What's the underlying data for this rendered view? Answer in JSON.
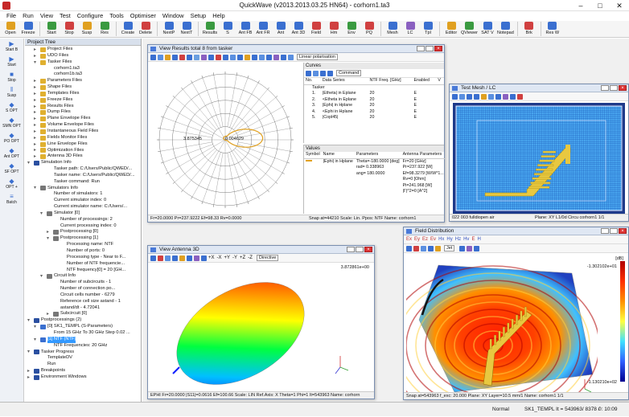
{
  "app": {
    "title": "QuickWave (v2013.2013.03.25 HN64) - corhorn1.ta3"
  },
  "menu": [
    "File",
    "Run",
    "View",
    "Test",
    "Configure",
    "Tools",
    "Optimiser",
    "Window",
    "Setup",
    "Help"
  ],
  "toolbar": [
    "Open",
    "Freeze",
    "Start",
    "Stop",
    "Susp",
    "Res",
    "Create",
    "Delete",
    "NextP",
    "NextT",
    "Results",
    "S",
    "Ant FB",
    "Ant FR",
    "Ant",
    "Ant 3D",
    "Field",
    "Hm",
    "Env",
    "PQ",
    "Mesh",
    "LC",
    "Tpl",
    "Editor",
    "QViewer",
    "SAT V",
    "Notepad",
    "Brk",
    "Res W"
  ],
  "leftstrip": [
    "Start B",
    "Start",
    "Stop",
    "Susp",
    "S OPT",
    "SMN OPT",
    "PO OPT",
    "Ant OPT",
    "SF OPT",
    "OPT +",
    "Batch"
  ],
  "tree": {
    "title": "Project Tree",
    "items": [
      "Project Files",
      "UDO Files",
      "Tasker Files",
      "corhorn1.ta3",
      "corhorn1b.ta3",
      "Parameters Files",
      "Shape Files",
      "Templates Files",
      "Freeze Files",
      "Results Files",
      "Dump Files",
      "Plane Envelope Files",
      "Volume Envelope Files",
      "Instantaneous Field Files",
      "Fields Monitor Files",
      "Line Envelope Files",
      "Optimization Files",
      "Antenna 3D Files",
      "Simulation Info",
      "Tasker path: C:/Users/Public/QWED/...",
      "Tasker name: C:/Users/Public/QWED/...",
      "Tasker command: Run",
      "Simulators Info",
      "Number of simulators: 1",
      "Current simulator index: 0",
      "Current simulator name: C:/Users/...",
      "Simulator [0]",
      "Number of processings: 2",
      "Current processing index: 0",
      "Postprocessing [0]",
      "Postprocessing [1]",
      "Processing name: NTF",
      "Number of ports: 0",
      "Processing type - Near to F...",
      "Number of NTF frequencie...",
      "NTF frequency[0] = 20 [GH...",
      "Circuit Info",
      "Number of subcircuits - 1",
      "Number of connection po...",
      "Circuit cells number - 6279",
      "Reference cell size astand - 1",
      "astand/dt - 4.72041",
      "Subcircuit [0]",
      "Postprocessings (2)",
      "[0] SK1_TEMPL (S-Parameters)",
      "From 15 GHz To 30 GHz Step 0.02 ...",
      "[1] NTF (NTF)",
      "NTF Frequencies: 20 GHz",
      "Tasker Progress",
      "TemplateDV",
      "Run",
      "Breakpoints",
      "Environment Windows"
    ]
  },
  "win_results": {
    "title": "View Results total 8 from tasker",
    "polarisation": "Linear polarisation",
    "label_a": "3.875345",
    "label_b": "0.004629",
    "status": "Fr=20.0000  Pr=237.9222  Ef=98.33  Rv=0.0000",
    "status2": "Snap at=44210    Scale: Lin.  Ppos: NTF  Name: corhorn1",
    "curves_title": "Curves",
    "command": "Command",
    "values_title": "Values",
    "curve_headers": [
      "No.",
      "Data Series",
      "NTF Freq. [GHz]",
      "Enabled",
      "V"
    ],
    "curve_parent": "Tasker",
    "curves": [
      [
        "1.",
        "|Etheta| in Eplane",
        "20",
        "E"
      ],
      [
        "2.",
        "<Etheta in Eplane",
        "20",
        "E"
      ],
      [
        "3.",
        "|Ephi| in Hplane",
        "20",
        "E"
      ],
      [
        "4.",
        "<Ephi in Hplane",
        "20",
        "E"
      ],
      [
        "5.",
        "|Copl45|",
        "20",
        "E"
      ]
    ],
    "value_headers": [
      "Symbol",
      "Name",
      "Parameters",
      "Antenna Parameters"
    ],
    "value_row": [
      "|Ephi| in Hplane",
      "Theta=-180.0000 [deg]",
      "Fr=20 [GHz]"
    ],
    "value_lines": [
      "rad= 0.338963",
      "Pr=237.922 [W]",
      "ang= 180.0000",
      "Ef=98.3279 [W/W*1...",
      "Rv=0 [Ohm]",
      "Pi=241.968 [W]",
      "|Γ|^2=0 [A^2]"
    ]
  },
  "win_mesh": {
    "title": "Test Mesh / LC",
    "status": "022  003 fulldiopen   air",
    "status2": "Plane: XY  L1/0d  Circu  corhorn1  1/1"
  },
  "win_ant": {
    "title": "View Antenna 3D",
    "mode": "Directive",
    "max": "3.872861e+00",
    "status": "EPHI  Fr=20.0000  |S11|=0.0616  Ef=100.66  Scale: LIN  Ref.Axis: X  Theta=1  Phi=1  It=543963  Name: corhorn"
  },
  "win_field": {
    "title": "Field Distribution",
    "component": "Jet",
    "max": "-1.302102e+01",
    "min": "-1.130210e+02",
    "unit": "[dB]",
    "status": "Snap at=543963  f_exc: 20.000  Plane: XY  Layer=10.5 mm/1  Name: corhorn1  1/1"
  },
  "statusbar": {
    "mode": "Normal",
    "info": "SK1_TEMPL  It = 543963/ 8378 /",
    "time": "0: 10:09"
  }
}
